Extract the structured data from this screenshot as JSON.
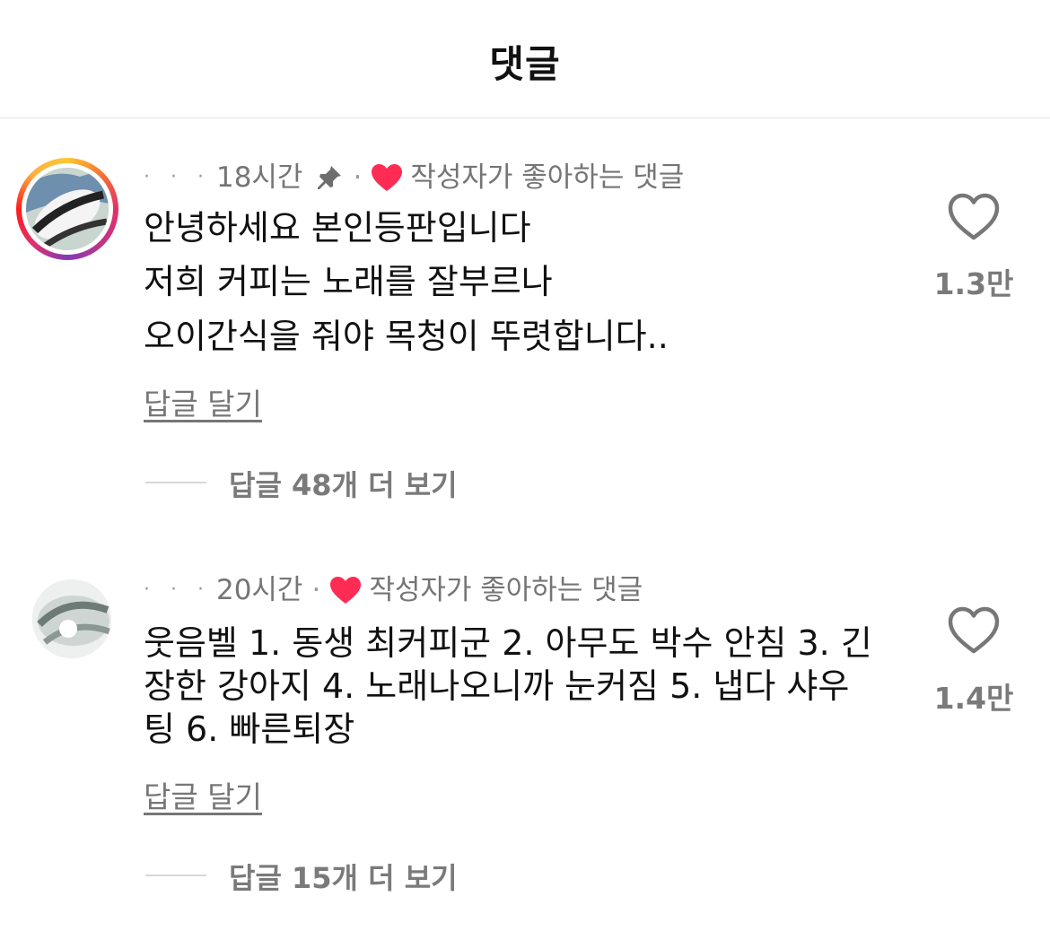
{
  "header": {
    "title": "댓글"
  },
  "comments": [
    {
      "time": "18시간",
      "liked_by_author_label": "작성자가 좋아하는 댓글",
      "lines": [
        "안녕하세요 본인등판입니다",
        "저희 커피는 노래를 잘부르나",
        "오이간식을 줘야 목청이 뚜렷합니다.."
      ],
      "reply_label": "답글 달기",
      "more_replies_label": "답글 48개 더 보기",
      "like_count": "1.3만",
      "pinned": true
    },
    {
      "time": "20시간",
      "liked_by_author_label": "작성자가 좋아하는 댓글",
      "lines": [
        "웃음벨 1. 동생 최커피군 2. 아무도 박수 안침 3. 긴",
        "장한 강아지 4. 노래나오니까 눈커짐 5. 냅다 샤우",
        "팅 6. 빠른퇴장"
      ],
      "reply_label": "답글 달기",
      "more_replies_label": "답글 15개 더 보기",
      "like_count": "1.4만",
      "pinned": false
    }
  ],
  "colors": {
    "heart": "#fe2c55",
    "meta_text": "#757575",
    "secondary_bold": "#7a7a7a"
  },
  "icons": {
    "pin": "pin-icon",
    "heart": "heart-icon",
    "like": "heart-outline-icon"
  }
}
